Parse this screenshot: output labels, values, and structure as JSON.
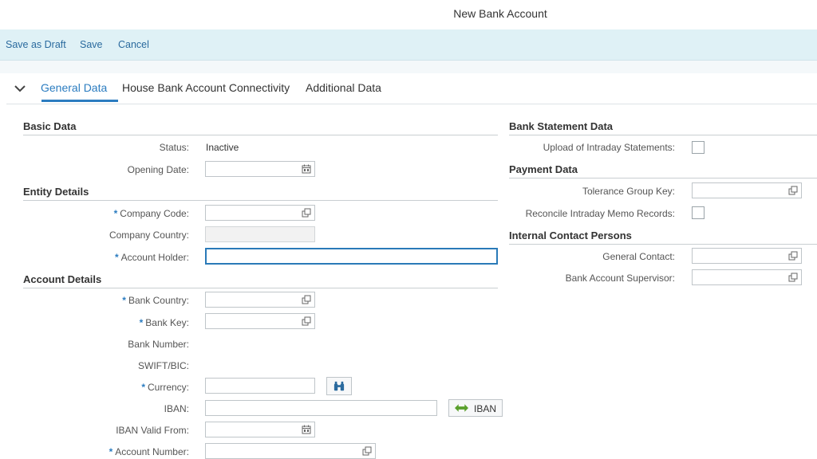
{
  "window": {
    "title": "New Bank Account"
  },
  "toolbar": {
    "save_draft": "Save as Draft",
    "save": "Save",
    "cancel": "Cancel"
  },
  "tabs": [
    {
      "label": "General Data",
      "active": true
    },
    {
      "label": "House Bank Account Connectivity",
      "active": false
    },
    {
      "label": "Additional Data",
      "active": false
    }
  ],
  "required_marker": "*",
  "sections": {
    "basic": "Basic Data",
    "entity": "Entity Details",
    "account": "Account Details",
    "bank_statement": "Bank Statement Data",
    "payment": "Payment Data",
    "contacts": "Internal Contact Persons"
  },
  "fields": {
    "status": {
      "label": "Status:",
      "value": "Inactive"
    },
    "opening_date": {
      "label": "Opening Date:",
      "value": ""
    },
    "company_code": {
      "label": "Company Code:",
      "value": ""
    },
    "company_country": {
      "label": "Company Country:",
      "value": ""
    },
    "account_holder": {
      "label": "Account Holder:",
      "value": ""
    },
    "bank_country": {
      "label": "Bank Country:",
      "value": ""
    },
    "bank_key": {
      "label": "Bank Key:",
      "value": ""
    },
    "bank_number": {
      "label": "Bank Number:",
      "value": ""
    },
    "swift_bic": {
      "label": "SWIFT/BIC:",
      "value": ""
    },
    "currency": {
      "label": "Currency:",
      "value": ""
    },
    "iban": {
      "label": "IBAN:",
      "value": ""
    },
    "iban_button": "IBAN",
    "iban_valid_from": {
      "label": "IBAN Valid From:",
      "value": ""
    },
    "account_number": {
      "label": "Account Number:",
      "value": ""
    },
    "upload_intraday": {
      "label": "Upload of Intraday Statements:",
      "checked": false
    },
    "tolerance_group": {
      "label": "Tolerance Group Key:",
      "value": ""
    },
    "reconcile_intraday": {
      "label": "Reconcile Intraday Memo Records:",
      "checked": false
    },
    "general_contact": {
      "label": "General Contact:",
      "value": ""
    },
    "supervisor": {
      "label": "Bank Account Supervisor:",
      "value": ""
    }
  },
  "colors": {
    "accent": "#2b7cc0",
    "toolbar_bg": "#dff1f6",
    "link": "#2a6a9e"
  }
}
